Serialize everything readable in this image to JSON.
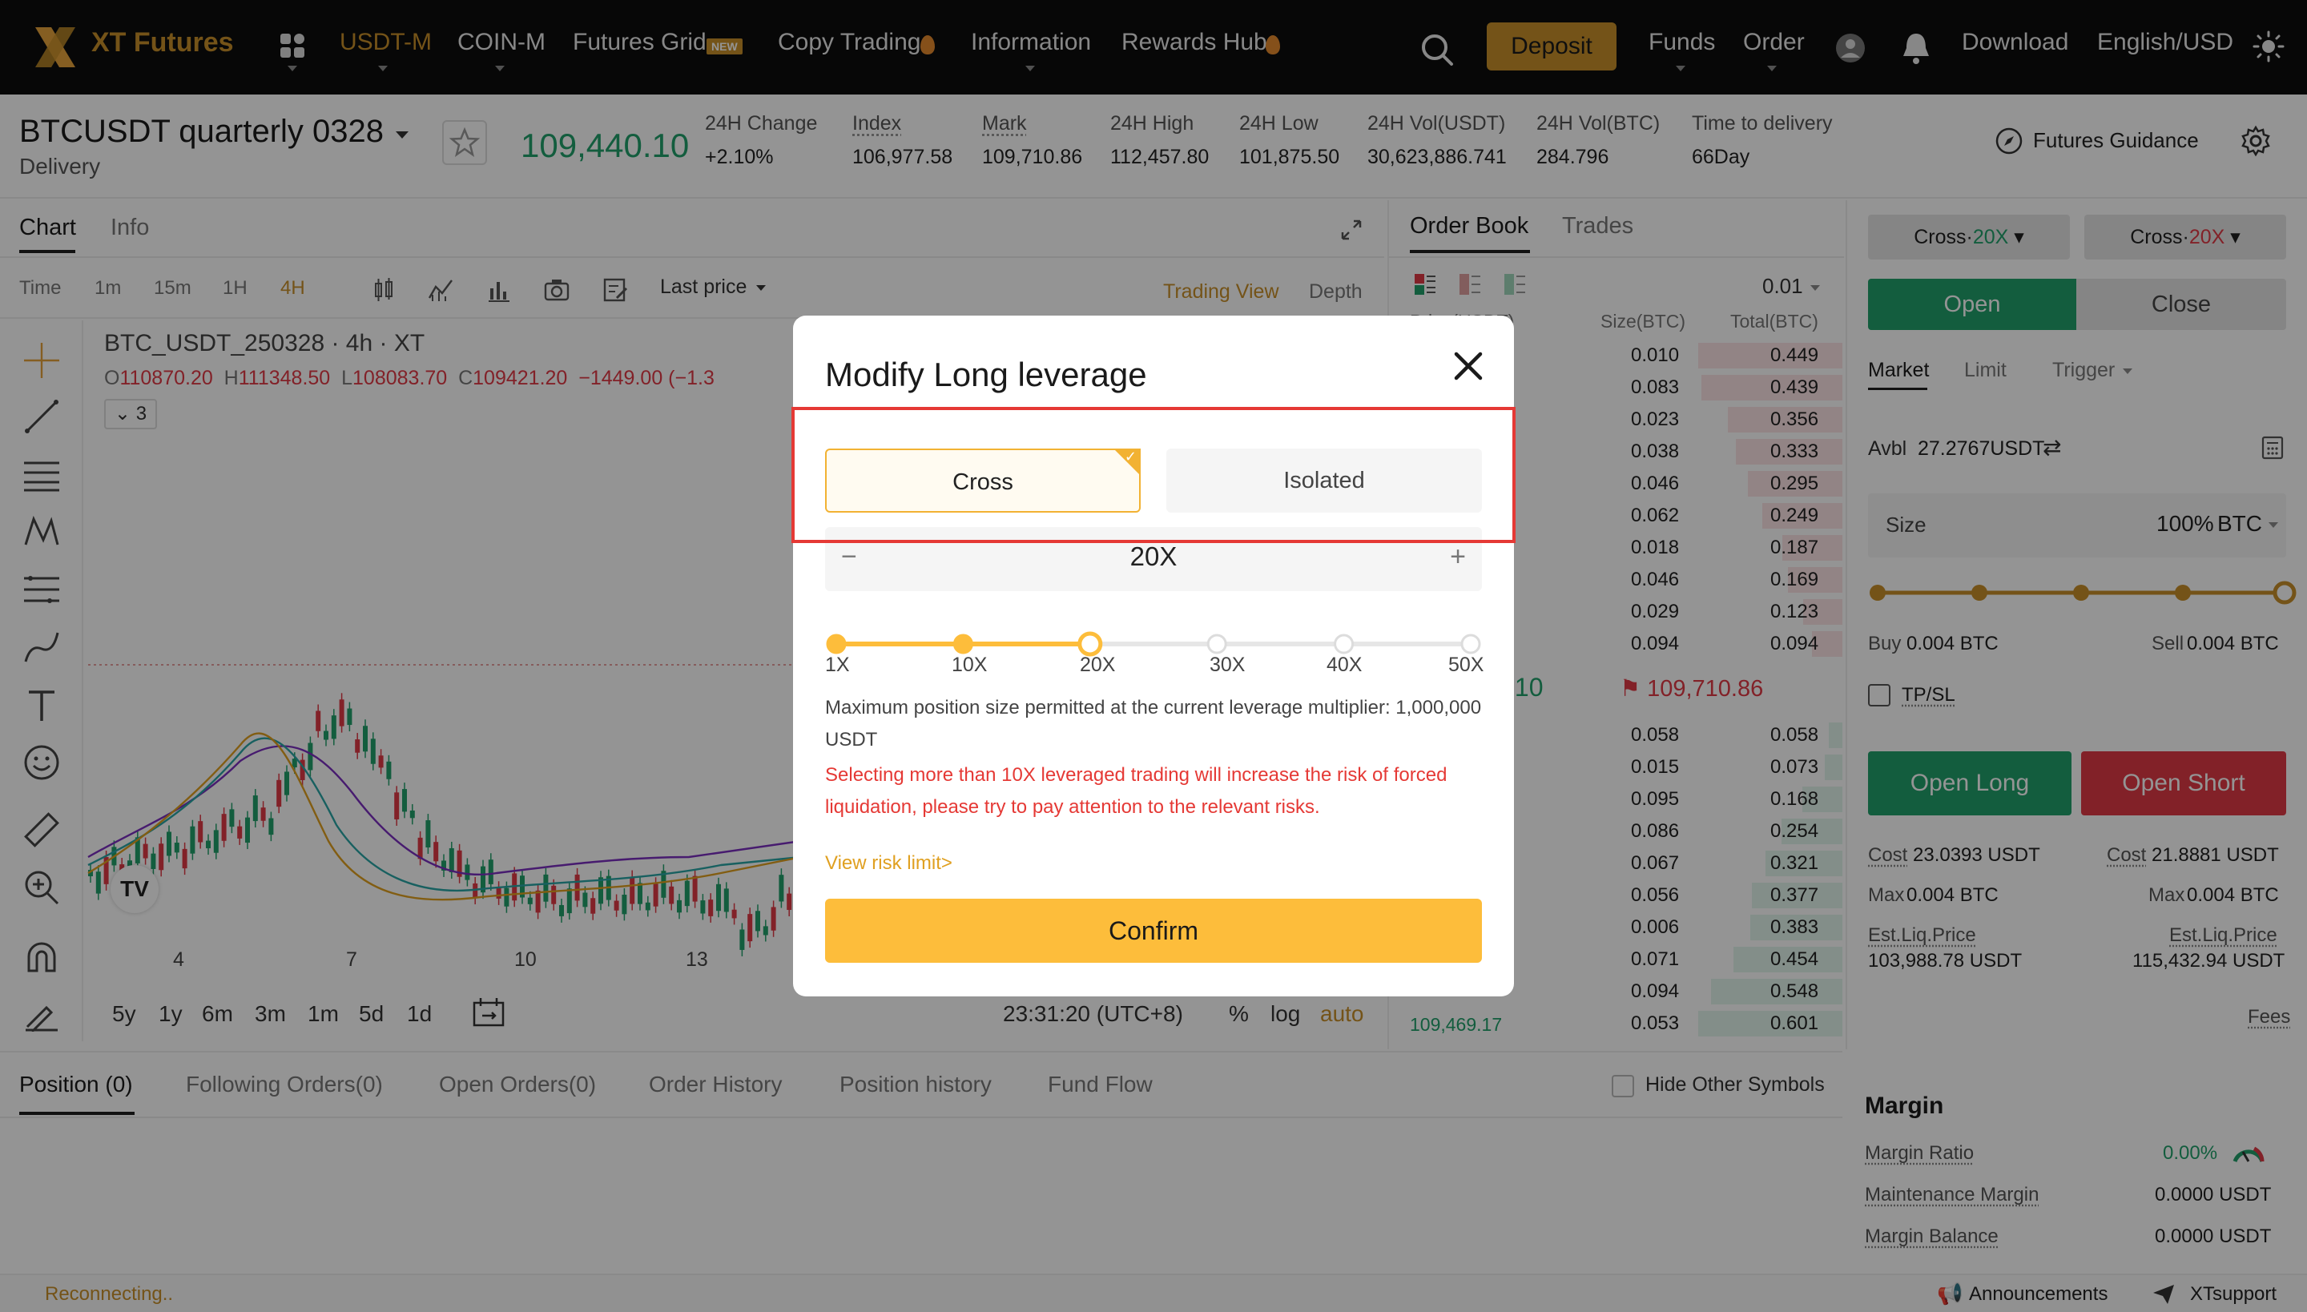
{
  "nav": {
    "brand": "XT Futures",
    "items": [
      {
        "label": "USDT-M",
        "active": true
      },
      {
        "label": "COIN-M"
      },
      {
        "label": "Futures Grid",
        "badge": "NEW"
      },
      {
        "label": "Copy Trading"
      },
      {
        "label": "Information"
      },
      {
        "label": "Rewards Hub"
      }
    ],
    "deposit": "Deposit",
    "funds": "Funds",
    "order": "Order",
    "download": "Download",
    "language": "English/USD",
    "accent": "#c8902a"
  },
  "ticker": {
    "symbol": "BTCUSDT quarterly 0328",
    "subtitle": "Delivery",
    "last_price": "109,440.10",
    "change_label": "24H Change",
    "change": "+2.10%",
    "index_label": "Index",
    "index": "106,977.58",
    "mark_label": "Mark",
    "mark": "109,710.86",
    "high_label": "24H High",
    "high": "112,457.80",
    "low_label": "24H Low",
    "low": "101,875.50",
    "vol_usdt_label": "24H Vol(USDT)",
    "vol_usdt": "30,623,886.741",
    "vol_btc_label": "24H Vol(BTC)",
    "vol_btc": "284.796",
    "delivery_label": "Time to delivery",
    "delivery": "66Day",
    "guidance": "Futures Guidance"
  },
  "chart": {
    "tabs": [
      "Chart",
      "Info"
    ],
    "intervals": [
      "Time",
      "1m",
      "15m",
      "1H",
      "4H"
    ],
    "price_type": "Last price",
    "trading_view": "Trading View",
    "depth": "Depth",
    "title": "BTC_USDT_250328 · 4h · XT",
    "ohlc": {
      "o": "110870.20",
      "h": "111348.50",
      "l": "108083.70",
      "c": "109421.20",
      "chg": "−1449.00 (−1.3"
    },
    "indicator_count": "3",
    "x_ticks": [
      "4",
      "7",
      "10",
      "13"
    ],
    "ranges": [
      "5y",
      "1y",
      "6m",
      "3m",
      "1m",
      "5d",
      "1d"
    ],
    "clock": "23:31:20 (UTC+8)",
    "pct": "%",
    "log": "log",
    "auto": "auto"
  },
  "orderbook": {
    "tabs": [
      "Order Book",
      "Trades"
    ],
    "precision": "0.01",
    "col_price": "Price(USDT)",
    "col_size": "Size(BTC)",
    "col_total": "Total(BTC)",
    "asks": [
      {
        "size": "0.010",
        "total": "0.449"
      },
      {
        "size": "0.083",
        "total": "0.439"
      },
      {
        "size": "0.023",
        "total": "0.356"
      },
      {
        "size": "0.038",
        "total": "0.333"
      },
      {
        "size": "0.046",
        "total": "0.295"
      },
      {
        "size": "0.062",
        "total": "0.249"
      },
      {
        "size": "0.018",
        "total": "0.187"
      },
      {
        "size": "0.046",
        "total": "0.169"
      },
      {
        "size": "0.029",
        "total": "0.123"
      },
      {
        "size": "0.094",
        "total": "0.094"
      }
    ],
    "last_fragment": ".10",
    "mark_price": "109,710.86",
    "bids": [
      {
        "size": "0.058",
        "total": "0.058"
      },
      {
        "size": "0.015",
        "total": "0.073"
      },
      {
        "size": "0.095",
        "total": "0.168"
      },
      {
        "size": "0.086",
        "total": "0.254"
      },
      {
        "size": "0.067",
        "total": "0.321"
      },
      {
        "size": "0.056",
        "total": "0.377"
      },
      {
        "size": "0.006",
        "total": "0.383"
      },
      {
        "size": "0.071",
        "total": "0.454"
      },
      {
        "size": "0.094",
        "total": "0.548"
      },
      {
        "size": "0.053",
        "total": "0.601"
      }
    ],
    "bottom_price": "109,469.17"
  },
  "trade": {
    "cross_left": "Cross",
    "lev_left": "20X",
    "cross_right": "Cross",
    "lev_right": "20X",
    "open": "Open",
    "close": "Close",
    "order_types": [
      "Market",
      "Limit",
      "Trigger"
    ],
    "avbl_label": "Avbl",
    "avbl": "27.2767USDT",
    "size_label": "Size",
    "size_value": "100%",
    "size_unit": "BTC",
    "size_fraction": 1.0,
    "buy_label": "Buy",
    "buy": "0.004 BTC",
    "sell_label": "Sell",
    "sell": "0.004 BTC",
    "tpsl": "TP/SL",
    "open_long": "Open Long",
    "open_short": "Open Short",
    "cost_label": "Cost",
    "cost_long": "23.0393 USDT",
    "cost_short": "21.8881 USDT",
    "max_label": "Max",
    "max_long": "0.004 BTC",
    "max_short": "0.004 BTC",
    "liq_label": "Est.Liq.Price",
    "liq_long": "103,988.78 USDT",
    "liq_short": "115,432.94 USDT",
    "fees": "Fees"
  },
  "margin": {
    "title": "Margin",
    "ratio_label": "Margin Ratio",
    "ratio": "0.00%",
    "maint_label": "Maintenance Margin",
    "maint": "0.0000 USDT",
    "balance_label": "Margin Balance",
    "balance": "0.0000 USDT"
  },
  "positions": {
    "tabs": [
      "Position (0)",
      "Following Orders(0)",
      "Open Orders(0)",
      "Order History",
      "Position history",
      "Fund Flow"
    ],
    "hide_other": "Hide Other Symbols"
  },
  "status": {
    "connection": "Reconnecting..",
    "announcements": "Announcements",
    "support": "XTsupport"
  },
  "modal": {
    "title": "Modify Long leverage",
    "mode_cross": "Cross",
    "mode_isolated": "Isolated",
    "leverage_display": "20X",
    "leverage_value": 20,
    "minus": "−",
    "plus": "+",
    "ticks": [
      "1X",
      "10X",
      "20X",
      "30X",
      "40X",
      "50X"
    ],
    "note": "Maximum position size permitted at the current leverage multiplier:  1,000,000 USDT",
    "warning": "Selecting more than 10X leveraged trading will increase the risk of forced liquidation, please try to pay attention to the relevant risks.",
    "risk_link": "View risk limit>",
    "confirm": "Confirm",
    "accent": "#fdbd3b",
    "highlight_color": "#e53935"
  }
}
